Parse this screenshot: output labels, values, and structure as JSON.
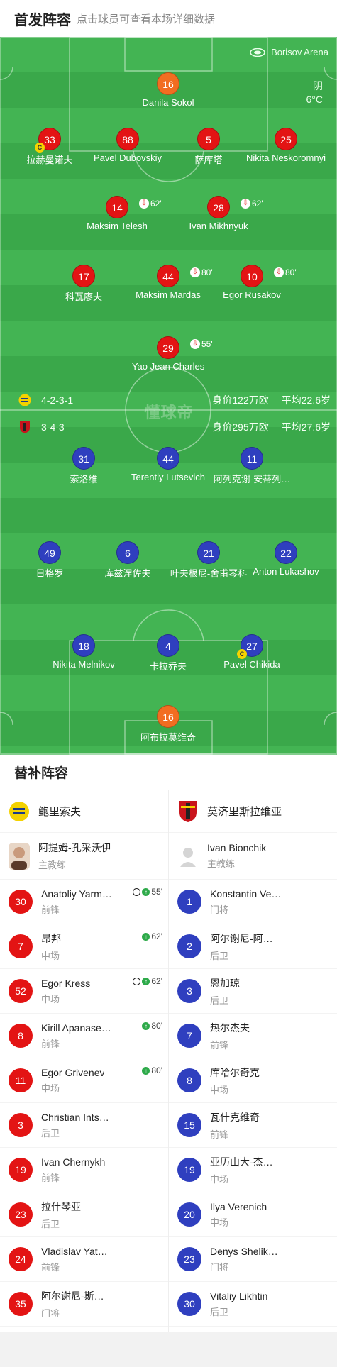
{
  "header": {
    "title": "首发阵容",
    "hint": "点击球员可查看本场详细数据"
  },
  "pitch": {
    "venue": "Borisov Arena",
    "weather": "阴",
    "temperature": "6°C",
    "watermark": "懂球帝",
    "colors": {
      "grass": "#3aa84a",
      "home_kit": "#e31414",
      "away_kit": "#2f3fbf",
      "goalkeeper_kit": "#f26d21"
    }
  },
  "home": {
    "formation": "4-2-3-1",
    "value": "身价122万欧",
    "avg_age": "平均22.6岁",
    "players": [
      {
        "num": "16",
        "name": "Danila Sokol"
      },
      {
        "num": "33",
        "name": "拉赫曼诺夫",
        "captain": "C"
      },
      {
        "num": "88",
        "name": "Pavel Dubovskiy"
      },
      {
        "num": "5",
        "name": "萨库塔"
      },
      {
        "num": "25",
        "name": "Nikita Neskoromnyi"
      },
      {
        "num": "14",
        "name": "Maksim Telesh",
        "sub": "62'"
      },
      {
        "num": "28",
        "name": "Ivan Mikhnyuk",
        "sub": "62'"
      },
      {
        "num": "17",
        "name": "科瓦廖夫"
      },
      {
        "num": "44",
        "name": "Maksim Mardas",
        "sub": "80'"
      },
      {
        "num": "10",
        "name": "Egor Rusakov",
        "sub": "80'"
      },
      {
        "num": "29",
        "name": "Yao Jean Charles",
        "sub": "55'"
      }
    ]
  },
  "away": {
    "formation": "3-4-3",
    "value": "身价295万欧",
    "avg_age": "平均27.6岁",
    "players": [
      {
        "num": "31",
        "name": "索洛维"
      },
      {
        "num": "44",
        "name": "Terentiy Lutsevich"
      },
      {
        "num": "11",
        "name": "阿列克谢-安蒂列…"
      },
      {
        "num": "49",
        "name": "日格罗"
      },
      {
        "num": "6",
        "name": "库兹涅佐夫"
      },
      {
        "num": "21",
        "name": "叶夫根尼-舍甫琴科"
      },
      {
        "num": "22",
        "name": "Anton Lukashov"
      },
      {
        "num": "18",
        "name": "Nikita Melnikov"
      },
      {
        "num": "4",
        "name": "卡拉乔夫"
      },
      {
        "num": "27",
        "name": "Pavel Chikida",
        "captain": "C"
      },
      {
        "num": "16",
        "name": "阿布拉莫维奇"
      }
    ]
  },
  "subs": {
    "title": "替补阵容",
    "home": {
      "team": "鲍里索夫",
      "coach": {
        "name": "阿提姆-孔采沃伊",
        "role": "主教练"
      },
      "list": [
        {
          "num": "30",
          "name": "Anatoliy Yarm…",
          "pos": "前锋",
          "goal": true,
          "in": "55'"
        },
        {
          "num": "7",
          "name": "昂邦",
          "pos": "中场",
          "goal": false,
          "in": "62'"
        },
        {
          "num": "52",
          "name": "Egor Kress",
          "pos": "中场",
          "goal": true,
          "in": "62'"
        },
        {
          "num": "8",
          "name": "Kirill Apanase…",
          "pos": "前锋",
          "goal": false,
          "in": "80'"
        },
        {
          "num": "11",
          "name": "Egor Grivenev",
          "pos": "中场",
          "goal": false,
          "in": "80'"
        },
        {
          "num": "3",
          "name": "Christian Ints…",
          "pos": "后卫"
        },
        {
          "num": "19",
          "name": "Ivan Chernykh",
          "pos": "前锋"
        },
        {
          "num": "23",
          "name": "拉什琴亚",
          "pos": "后卫"
        },
        {
          "num": "24",
          "name": "Vladislav Yat…",
          "pos": "前锋"
        },
        {
          "num": "35",
          "name": "阿尔谢尼-斯…",
          "pos": "门将"
        }
      ]
    },
    "away": {
      "team": "莫济里斯拉维亚",
      "coach": {
        "name": "Ivan Bionchik",
        "role": "主教练"
      },
      "list": [
        {
          "num": "1",
          "name": "Konstantin Ve…",
          "pos": "门将"
        },
        {
          "num": "2",
          "name": "阿尔谢尼-阿…",
          "pos": "后卫"
        },
        {
          "num": "3",
          "name": "恩加琼",
          "pos": "后卫"
        },
        {
          "num": "7",
          "name": "热尔杰夫",
          "pos": "前锋"
        },
        {
          "num": "8",
          "name": "库哈尔奇克",
          "pos": "中场"
        },
        {
          "num": "15",
          "name": "瓦什克维奇",
          "pos": "前锋"
        },
        {
          "num": "19",
          "name": "亚历山大-杰…",
          "pos": "中场"
        },
        {
          "num": "20",
          "name": "Ilya Verenich",
          "pos": "中场"
        },
        {
          "num": "23",
          "name": "Denys Shelik…",
          "pos": "门将"
        },
        {
          "num": "30",
          "name": "Vitaliy Likhtin",
          "pos": "后卫"
        }
      ]
    }
  }
}
